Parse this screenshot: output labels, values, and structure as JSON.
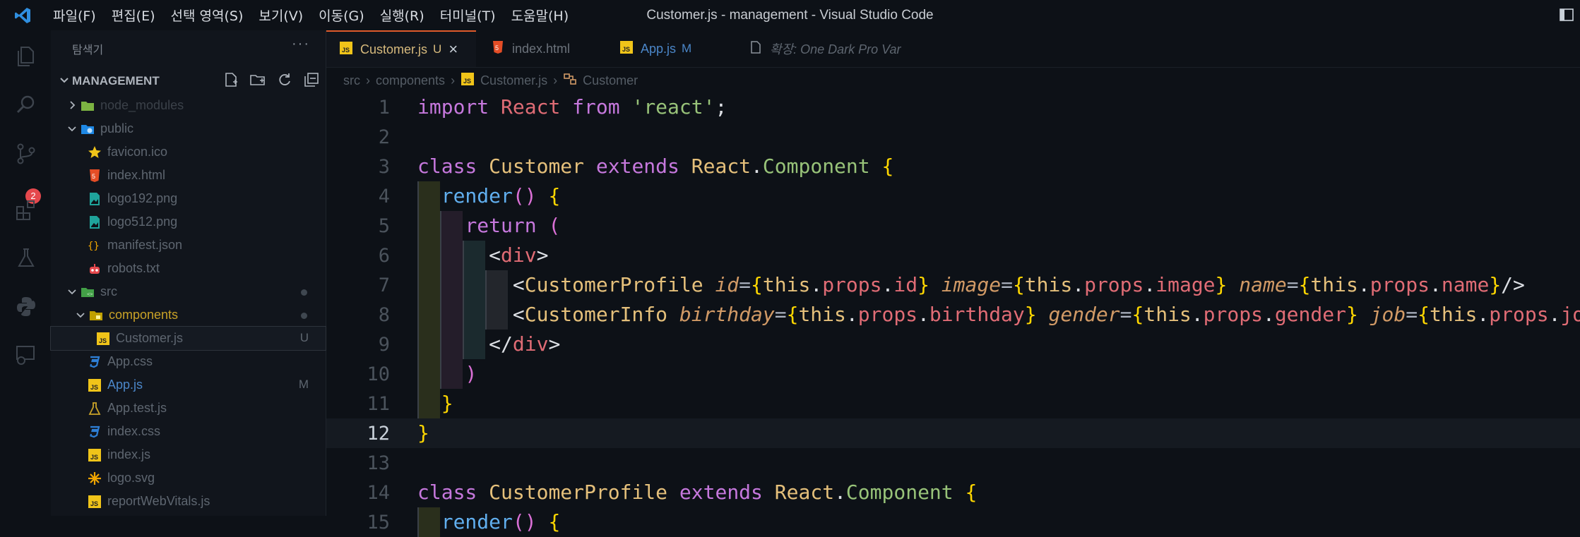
{
  "titlebar": {
    "menu": [
      "파일(F)",
      "편집(E)",
      "선택 영역(S)",
      "보기(V)",
      "이동(G)",
      "실행(R)",
      "터미널(T)",
      "도움말(H)"
    ],
    "title": "Customer.js - management - Visual Studio Code"
  },
  "activity": {
    "items": [
      "explorer-icon",
      "search-icon",
      "source-control-icon",
      "extensions-icon",
      "testing-icon",
      "python-icon",
      "remote-explorer-icon"
    ],
    "scm_badge": "2"
  },
  "sidebar": {
    "header": "탐색기",
    "more": "···",
    "project": "MANAGEMENT",
    "tree": [
      {
        "label": "node_modules",
        "icon": "folder-node",
        "depth": 0,
        "kind": "folder-closed",
        "status": "",
        "color": "#3b4149"
      },
      {
        "label": "public",
        "icon": "folder-public",
        "depth": 0,
        "kind": "folder-open",
        "status": "",
        "color": "#5e6670"
      },
      {
        "label": "favicon.ico",
        "icon": "star",
        "depth": 1,
        "kind": "file",
        "status": "",
        "color": "#5e6670"
      },
      {
        "label": "index.html",
        "icon": "html",
        "depth": 1,
        "kind": "file",
        "status": "",
        "color": "#5e6670"
      },
      {
        "label": "logo192.png",
        "icon": "image",
        "depth": 1,
        "kind": "file",
        "status": "",
        "color": "#5e6670"
      },
      {
        "label": "logo512.png",
        "icon": "image",
        "depth": 1,
        "kind": "file",
        "status": "",
        "color": "#5e6670"
      },
      {
        "label": "manifest.json",
        "icon": "json",
        "depth": 1,
        "kind": "file",
        "status": "",
        "color": "#5e6670"
      },
      {
        "label": "robots.txt",
        "icon": "robot",
        "depth": 1,
        "kind": "file",
        "status": "",
        "color": "#5e6670"
      },
      {
        "label": "src",
        "icon": "folder-src",
        "depth": 0,
        "kind": "folder-open",
        "status": "dot",
        "color": "#5e6670"
      },
      {
        "label": "components",
        "icon": "folder-components",
        "depth": 1,
        "kind": "folder-open",
        "status": "dot",
        "color": "#c9a227"
      },
      {
        "label": "Customer.js",
        "icon": "js",
        "depth": 2,
        "kind": "file",
        "status": "U",
        "color": "#5e6670"
      },
      {
        "label": "App.css",
        "icon": "css",
        "depth": 1,
        "kind": "file",
        "status": "",
        "color": "#5e6670"
      },
      {
        "label": "App.js",
        "icon": "js",
        "depth": 1,
        "kind": "file",
        "status": "M",
        "color": "#4b86c8"
      },
      {
        "label": "App.test.js",
        "icon": "test",
        "depth": 1,
        "kind": "file",
        "status": "",
        "color": "#5e6670"
      },
      {
        "label": "index.css",
        "icon": "css",
        "depth": 1,
        "kind": "file",
        "status": "",
        "color": "#5e6670"
      },
      {
        "label": "index.js",
        "icon": "js",
        "depth": 1,
        "kind": "file",
        "status": "",
        "color": "#5e6670"
      },
      {
        "label": "logo.svg",
        "icon": "svg",
        "depth": 1,
        "kind": "file",
        "status": "",
        "color": "#5e6670"
      },
      {
        "label": "reportWebVitals.js",
        "icon": "js",
        "depth": 1,
        "kind": "file",
        "status": "",
        "color": "#5e6670"
      }
    ]
  },
  "tabs": [
    {
      "label": "Customer.js",
      "status": "U",
      "icon": "js",
      "active": true,
      "closable": true,
      "italic": false
    },
    {
      "label": "index.html",
      "status": "",
      "icon": "html",
      "active": false,
      "closable": false,
      "italic": false
    },
    {
      "label": "App.js",
      "status": "M",
      "icon": "js",
      "active": false,
      "closable": false,
      "italic": false
    },
    {
      "label": "확장: One Dark Pro Var",
      "status": "",
      "icon": "file",
      "active": false,
      "closable": false,
      "italic": true
    }
  ],
  "breadcrumb": [
    "src",
    "components",
    "Customer.js",
    "Customer"
  ],
  "editor": {
    "current_line": 12,
    "lines": [
      {
        "n": "1",
        "code": "import React from 'react';"
      },
      {
        "n": "2",
        "code": ""
      },
      {
        "n": "3",
        "code": "class Customer extends React.Component {"
      },
      {
        "n": "4",
        "code": "  render() {"
      },
      {
        "n": "5",
        "code": "    return ("
      },
      {
        "n": "6",
        "code": "      <div>"
      },
      {
        "n": "7",
        "code": "        <CustomerProfile id={this.props.id} image={this.props.image} name={this.props.name}/>"
      },
      {
        "n": "8",
        "code": "        <CustomerInfo birthday={this.props.birthday} gender={this.props.gender} job={this.props.job}/>"
      },
      {
        "n": "9",
        "code": "      </div>"
      },
      {
        "n": "10",
        "code": "    )"
      },
      {
        "n": "11",
        "code": "  }"
      },
      {
        "n": "12",
        "code": "}"
      },
      {
        "n": "13",
        "code": ""
      },
      {
        "n": "14",
        "code": "class CustomerProfile extends React.Component {"
      },
      {
        "n": "15",
        "code": "  render() {"
      }
    ]
  },
  "colors": {
    "accent": "#e05a2b",
    "keyword": "#c678dd",
    "class": "#e5c07b",
    "string": "#98c379",
    "tag": "#e06c75",
    "attribute": "#d19a66",
    "modified": "#4b86c8",
    "untracked": "#d7ba7d"
  }
}
